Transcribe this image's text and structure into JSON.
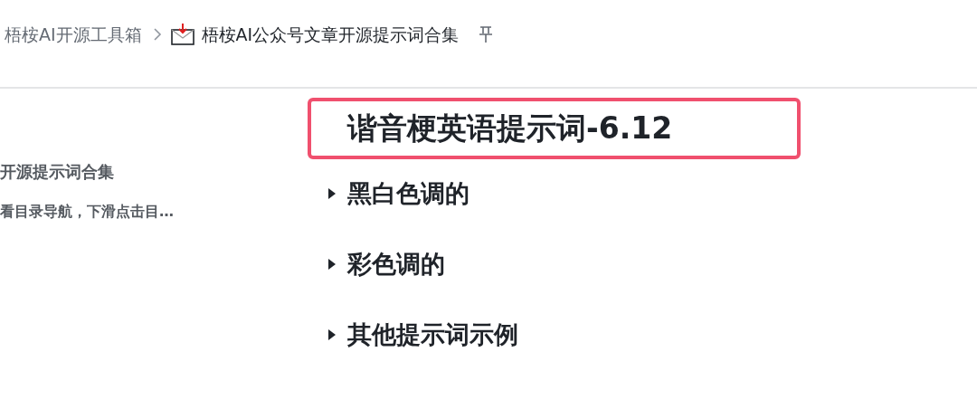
{
  "breadcrumb": {
    "parent": "梧桉AI开源工具箱",
    "current": "梧桉AI公众号文章开源提示词合集",
    "pinned": false
  },
  "sidebar": {
    "title": "开源提示词合集",
    "subtitle": "看目录导航，下滑点击目…"
  },
  "document": {
    "title": "谐音梗英语提示词-6.12",
    "title_highlighted": true,
    "sections": [
      {
        "heading": "黑白色调的",
        "expanded": false
      },
      {
        "heading": "彩色调的",
        "expanded": false
      },
      {
        "heading": "其他提示词示例",
        "expanded": false
      }
    ]
  }
}
